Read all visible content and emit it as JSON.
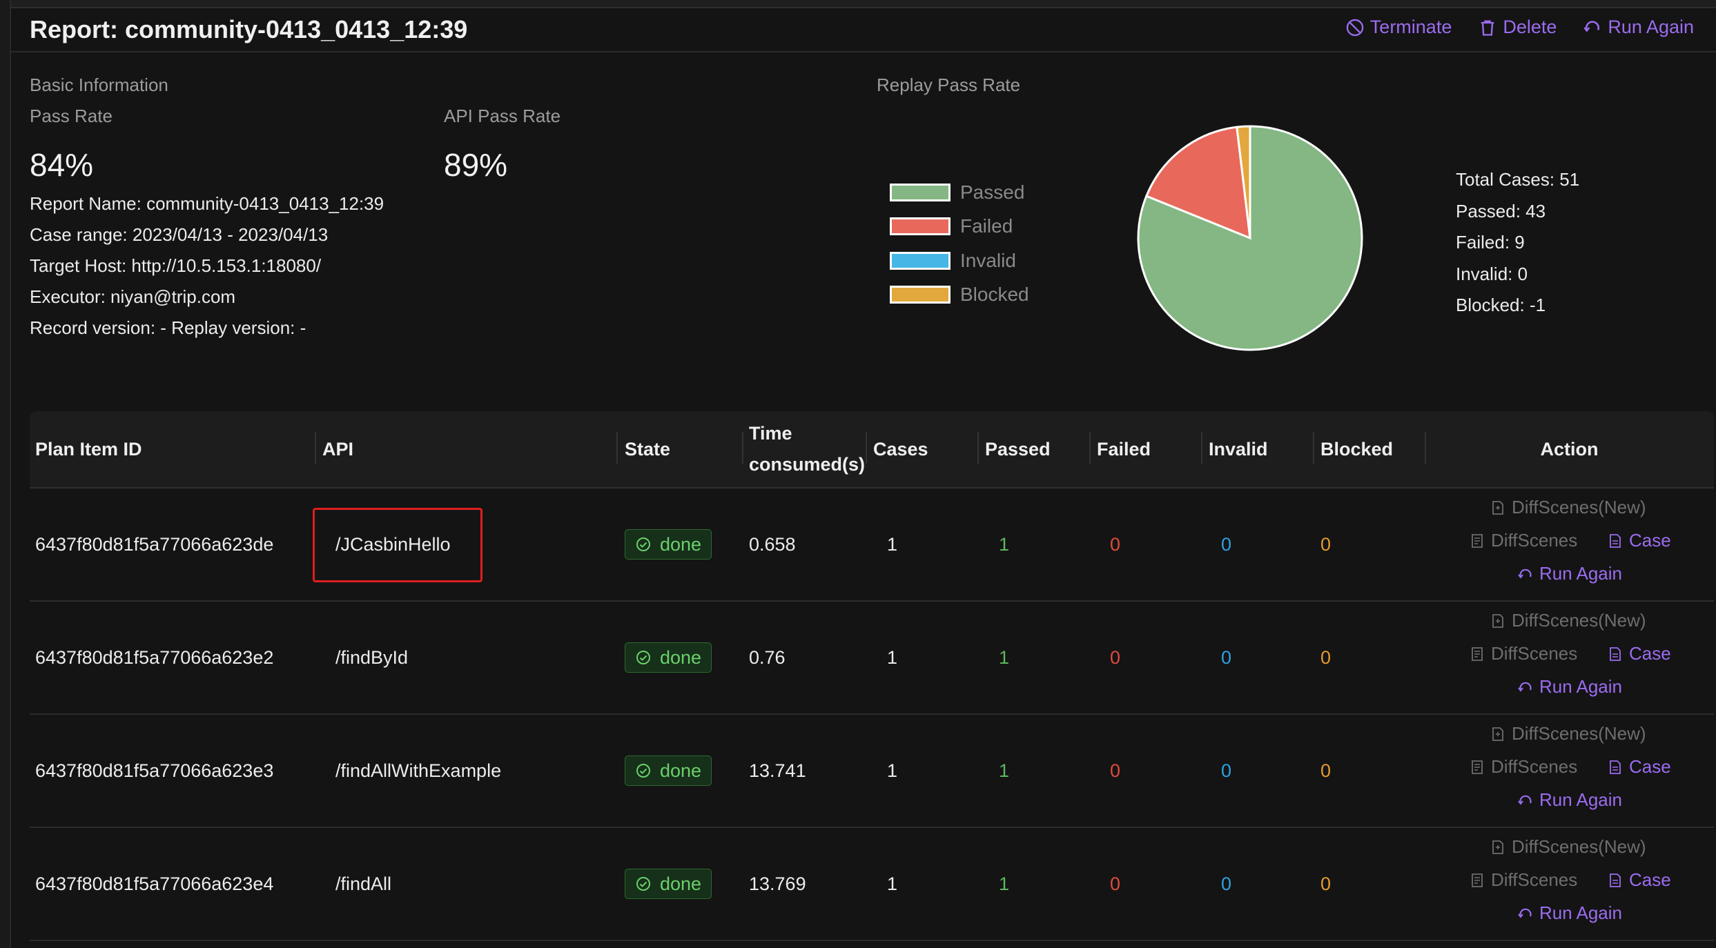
{
  "header": {
    "title": "Report: community-0413_0413_12:39",
    "actions": [
      {
        "label": "Terminate",
        "icon": "stop-icon"
      },
      {
        "label": "Delete",
        "icon": "trash-icon"
      },
      {
        "label": "Run Again",
        "icon": "redo-icon"
      }
    ]
  },
  "basic": {
    "section_label": "Basic Information",
    "pass_rate_label": "Pass Rate",
    "pass_rate": "84%",
    "api_pass_rate_label": "API Pass Rate",
    "api_pass_rate": "89%",
    "report_name": "Report Name: community-0413_0413_12:39",
    "case_range": "Case range: 2023/04/13 - 2023/04/13",
    "target_host": "Target Host: http://10.5.153.1:18080/",
    "executor": "Executor: niyan@trip.com",
    "versions": "Record version: - Replay version: -"
  },
  "replay": {
    "label": "Replay Pass Rate",
    "legend": [
      {
        "name": "Passed",
        "color": "#84b783"
      },
      {
        "name": "Failed",
        "color": "#e8695c"
      },
      {
        "name": "Invalid",
        "color": "#46b6e6"
      },
      {
        "name": "Blocked",
        "color": "#e2a83e"
      }
    ],
    "stats": {
      "total": "Total Cases: 51",
      "passed": "Passed: 43",
      "failed": "Failed: 9",
      "invalid": "Invalid: 0",
      "blocked": "Blocked: -1"
    }
  },
  "chart_data": {
    "type": "pie",
    "title": "Replay Pass Rate",
    "categories": [
      "Passed",
      "Failed",
      "Invalid",
      "Blocked"
    ],
    "values": [
      43,
      9,
      0,
      1
    ],
    "colors": [
      "#84b783",
      "#e8695c",
      "#46b6e6",
      "#e2a83e"
    ]
  },
  "table": {
    "headers": [
      "Plan Item ID",
      "API",
      "State",
      "Time consumed(s)",
      "Cases",
      "Passed",
      "Failed",
      "Invalid",
      "Blocked",
      "Action"
    ],
    "action_labels": {
      "diff_new": "DiffScenes(New)",
      "diff": "DiffScenes",
      "case": "Case",
      "run_again": "Run Again"
    },
    "rows": [
      {
        "id": "6437f80d81f5a77066a623de",
        "api": "/JCasbinHello",
        "state": "done",
        "time": "0.658",
        "cases": "1",
        "passed": "1",
        "failed": "0",
        "invalid": "0",
        "blocked": "0"
      },
      {
        "id": "6437f80d81f5a77066a623e2",
        "api": "/findById",
        "state": "done",
        "time": "0.76",
        "cases": "1",
        "passed": "1",
        "failed": "0",
        "invalid": "0",
        "blocked": "0"
      },
      {
        "id": "6437f80d81f5a77066a623e3",
        "api": "/findAllWithExample",
        "state": "done",
        "time": "13.741",
        "cases": "1",
        "passed": "1",
        "failed": "0",
        "invalid": "0",
        "blocked": "0"
      },
      {
        "id": "6437f80d81f5a77066a623e4",
        "api": "/findAll",
        "state": "done",
        "time": "13.769",
        "cases": "1",
        "passed": "1",
        "failed": "0",
        "invalid": "0",
        "blocked": "0"
      }
    ]
  },
  "colors": {
    "accent": "#9b6cf0",
    "passed": "#5cb85c",
    "failed": "#e04a3c",
    "invalid": "#2ea0e0",
    "blocked": "#e39a2e",
    "highlight": "#e01e1e"
  }
}
